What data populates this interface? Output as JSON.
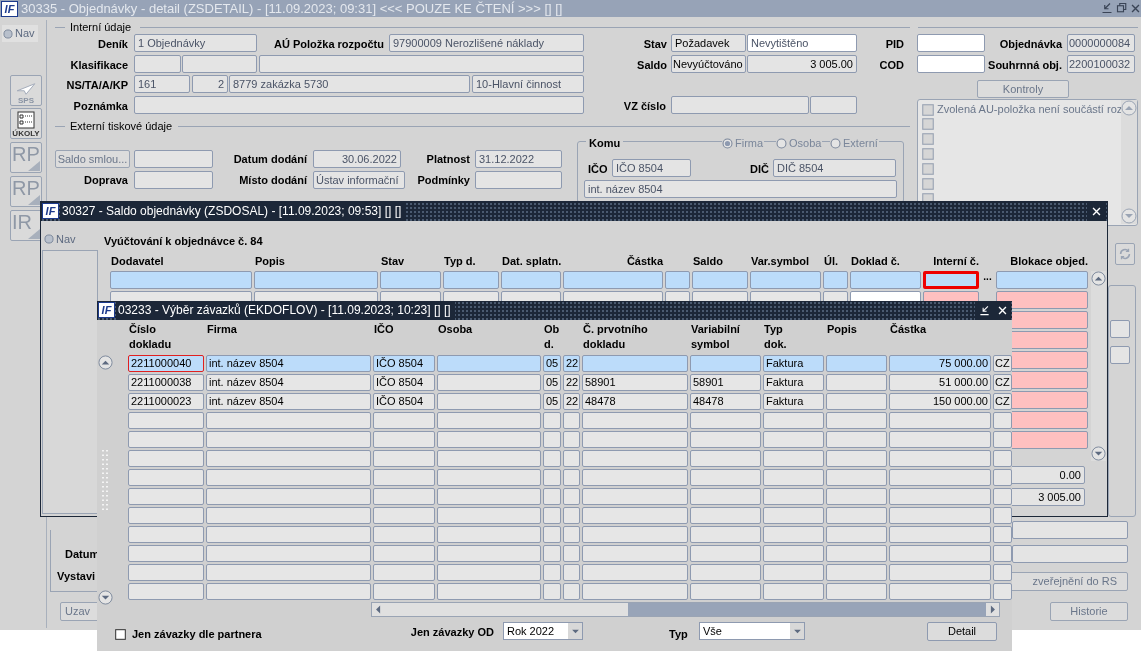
{
  "main_window": {
    "logo": "IF",
    "title": "30335 - Objednávky - detail (ZSDETAIL) - [11.09.2023; 09:31] <<< POUZE KE ČTENÍ >>> [] []",
    "nav": "Nav",
    "side_buttons": [
      {
        "kind": "icon",
        "label": "SPS"
      },
      {
        "kind": "icon",
        "label": "ÚKOLY"
      },
      {
        "kind": "text",
        "label": "RP"
      },
      {
        "kind": "text",
        "label": "RP"
      },
      {
        "kind": "text",
        "label": "IR"
      }
    ],
    "sections": [
      "Interní údaje",
      "Externí tiskové údaje"
    ],
    "labels": [
      "Deník",
      "AÚ Položka rozpočtu",
      "Stav",
      "PID",
      "Objednávka",
      "Klasifikace",
      "Saldo",
      "COD",
      "Souhrnná obj.",
      "NS/TA/A/KP",
      "Poznámka",
      "VZ číslo",
      "Datum dodání",
      "Platnost",
      "Doprava",
      "Místo dodání",
      "Podmínky",
      "IČO",
      "DIČ",
      "Datum",
      "Vystavi"
    ],
    "values": [
      "1 Objednávky",
      "97900009 Nerozlišené náklady",
      "Požadavek",
      "Nevytištěno",
      "0000000084",
      "Nevyúčtováno",
      "3 005.00",
      "2200100032",
      "161",
      "2",
      "8779 zakázka 5730",
      "10-Hlavní činnost",
      "30.06.2022",
      "31.12.2022",
      "Ústav informační",
      "IČO 8504",
      "DIČ 8504",
      "int. název 8504"
    ],
    "recipient": {
      "label": "Komu",
      "options": [
        {
          "label": "Firma",
          "selected": true
        },
        {
          "label": "Osoba",
          "selected": false
        },
        {
          "label": "Externí",
          "selected": false
        }
      ]
    },
    "buttons": [
      "Saldo smlou...",
      "Kontroly",
      "Uzav",
      "zveřejnění do RS",
      "Historie"
    ],
    "checks": [
      {
        "text": "Zvolená AU-položka není součástí roz",
        "checked": false
      },
      {
        "checked": false
      },
      {
        "checked": false
      },
      {
        "checked": false
      },
      {
        "checked": false
      },
      {
        "checked": false
      },
      {
        "checked": false
      }
    ]
  },
  "balance_window": {
    "logo": "IF",
    "title": "30327 - Saldo objednávky (ZSDOSAL) - [11.09.2023; 09:53] [] []",
    "nav": "Nav",
    "heading": "Vyúčtování k objednávce č. 84",
    "columns": [
      "Dodavatel",
      "Popis",
      "Stav",
      "Typ d.",
      "Dat. splatn.",
      "Částka",
      "Saldo",
      "Var.symbol",
      "Úl.",
      "Doklad č.",
      "Interní č.",
      "Blokace objed."
    ],
    "rows": [
      {
        "selected": true,
        "focused": true
      },
      {
        "selected": false
      },
      {
        "selected": false
      },
      {
        "selected": false
      },
      {
        "selected": false
      },
      {
        "selected": false
      },
      {
        "selected": false
      },
      {
        "selected": false
      },
      {
        "selected": false
      }
    ],
    "lookup_button": "...",
    "totals": [
      "0.00",
      "3 005.00"
    ]
  },
  "liabilities_window": {
    "logo": "IF",
    "title": "03233 - Výběr závazků (EKDOFLOV) - [11.09.2023; 10:23] [] []",
    "columns": [
      "Číslo dokladu",
      "Firma",
      "IČO",
      "Osoba",
      "Ob d.",
      "Č. prvotního dokladu",
      "Variabilní symbol",
      "Typ dok.",
      "Popis",
      "Částka"
    ],
    "rows": [
      {
        "selected": true,
        "focused": true,
        "doc_no": "2211000040",
        "company": "int. název 8504",
        "ico": "IČO 8504",
        "period": "05",
        "column_6": "22",
        "doc_type": "Faktura",
        "amount": "75 000.00",
        "column_12": "CZ"
      },
      {
        "selected": false,
        "focused": false,
        "doc_no": "2211000038",
        "company": "int. název 8504",
        "ico": "IČO 8504",
        "period": "05",
        "column_6": "22",
        "primary_doc": "58901",
        "var_symbol": "58901",
        "doc_type": "Faktura",
        "amount": "51 000.00",
        "column_12": "CZ"
      },
      {
        "selected": false,
        "focused": false,
        "doc_no": "2211000023",
        "company": "int. název 8504",
        "ico": "IČO 8504",
        "period": "05",
        "column_6": "22",
        "primary_doc": "48478",
        "var_symbol": "48478",
        "doc_type": "Faktura",
        "amount": "150 000.00",
        "column_12": "CZ"
      },
      {
        "selected": false,
        "focused": false
      },
      {
        "selected": false,
        "focused": false
      },
      {
        "selected": false,
        "focused": false
      },
      {
        "selected": false,
        "focused": false
      },
      {
        "selected": false,
        "focused": false
      },
      {
        "selected": false,
        "focused": false
      },
      {
        "selected": false,
        "focused": false
      },
      {
        "selected": false,
        "focused": false
      },
      {
        "selected": false,
        "focused": false
      },
      {
        "selected": false,
        "focused": false
      }
    ],
    "partner_only": {
      "label": "Jen závazky dle partnera",
      "checked": false
    },
    "from": {
      "label": "Jen závazky OD",
      "value": "Rok 2022"
    },
    "type": {
      "label": "Typ",
      "value": "Vše"
    },
    "detail_button": "Detail"
  }
}
